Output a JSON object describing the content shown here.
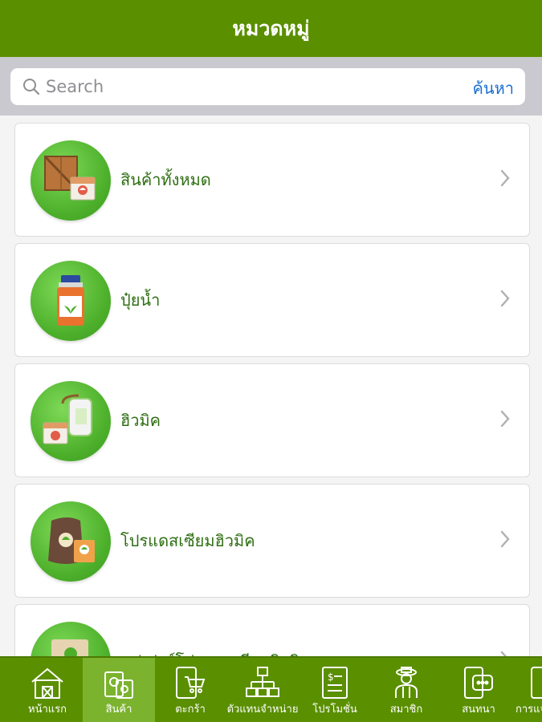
{
  "header": {
    "title": "หมวดหมู่"
  },
  "search": {
    "placeholder": "Search",
    "button_label": "ค้นหา"
  },
  "categories": [
    {
      "label": "สินค้าทั้งหมด",
      "icon": "crate-and-bag-icon"
    },
    {
      "label": "ปุ๋ยน้ำ",
      "icon": "fertilizer-bottle-icon"
    },
    {
      "label": "ฮิวมิค",
      "icon": "sprayer-and-bag-icon"
    },
    {
      "label": "โปรแดสเซียมฮิวมิค",
      "icon": "sack-and-box-icon"
    },
    {
      "label": "ซุปเปอร์โปรแดสเซียมฮิวมิค",
      "icon": "box-bag-icon"
    }
  ],
  "tabbar": {
    "items": [
      {
        "label": "หน้าแรก",
        "icon": "barn-home-icon"
      },
      {
        "label": "สินค้า",
        "icon": "product-bag-icon"
      },
      {
        "label": "ตะกร้า",
        "icon": "cart-icon"
      },
      {
        "label": "ตัวแทนจำหน่าย",
        "icon": "org-chart-icon"
      },
      {
        "label": "โปรโมชั่น",
        "icon": "promo-document-icon"
      },
      {
        "label": "สมาชิก",
        "icon": "farmer-icon"
      },
      {
        "label": "สนทนา",
        "icon": "chat-phone-icon"
      },
      {
        "label": "การแจ้ง",
        "icon": "phone-icon"
      }
    ],
    "active_index": 1
  },
  "colors": {
    "brand_green": "#5a8f00",
    "active_tab": "#7bb32e",
    "label_green": "#2e6e12",
    "link_blue": "#1a6fd4"
  }
}
